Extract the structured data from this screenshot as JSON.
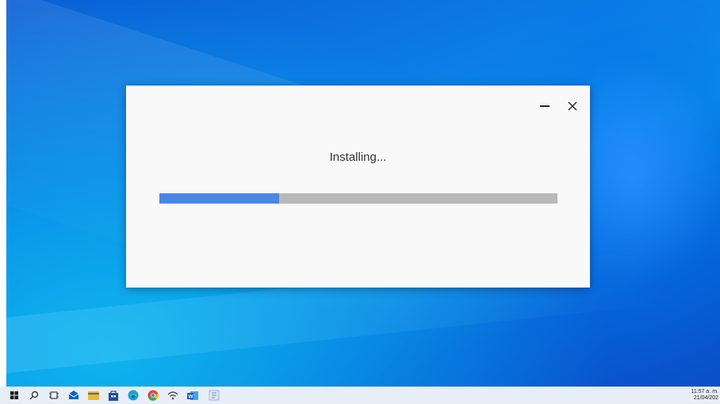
{
  "window": {
    "status_text": "Installing...",
    "progress_fraction": 0.3,
    "minimize_label": "–",
    "close_label": "✕"
  },
  "taskbar": {
    "icons": [
      "windows-start-icon",
      "search-icon",
      "task-view-icon",
      "mail-icon",
      "file-explorer-icon",
      "store-icon",
      "edge-icon",
      "chrome-icon",
      "wifi-icon",
      "word-icon",
      "installer-icon"
    ],
    "time": "11:57 a. m.",
    "date": "21/04/202"
  },
  "colors": {
    "progress_fill": "#4a86e4",
    "progress_track": "#b8b8b8",
    "window_bg": "#f9f9f9"
  }
}
